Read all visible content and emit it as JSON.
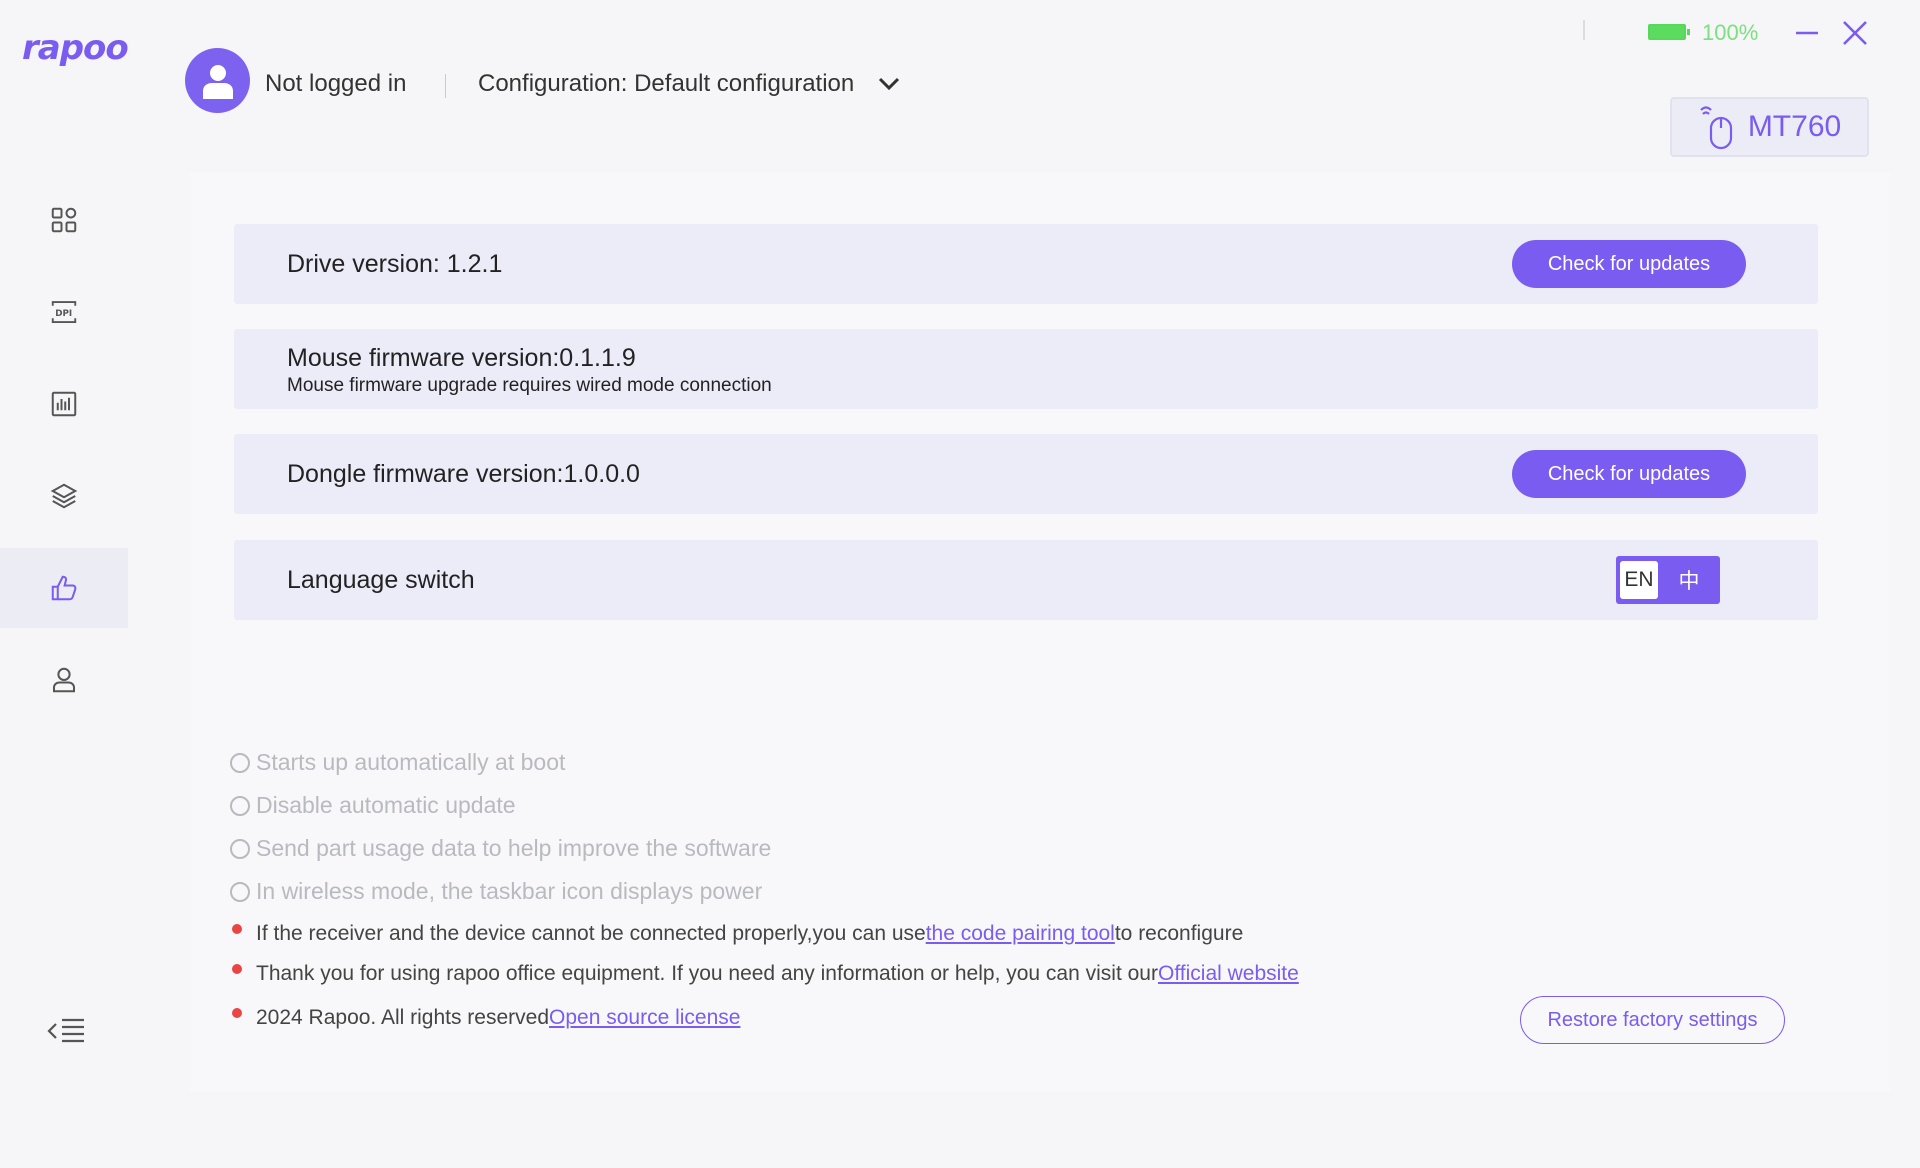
{
  "app": {
    "logo_text": "rapoo"
  },
  "sidebar": {
    "items": [
      {
        "name": "dashboard",
        "icon": "grid-icon",
        "active": false
      },
      {
        "name": "dpi",
        "icon": "dpi-icon",
        "active": false
      },
      {
        "name": "stats",
        "icon": "bar-chart-icon",
        "active": false
      },
      {
        "name": "layers",
        "icon": "layers-icon",
        "active": false
      },
      {
        "name": "settings",
        "icon": "thumbs-up-icon",
        "active": true
      },
      {
        "name": "account",
        "icon": "user-icon",
        "active": false
      }
    ],
    "collapse_icon": "collapse-menu-icon"
  },
  "header": {
    "login_status": "Not logged in",
    "configuration": "Configuration: Default configuration",
    "battery_percent": "100%",
    "battery_level": 1.0,
    "device_name": "MT760"
  },
  "cards": {
    "drive": {
      "title": "Drive version: 1.2.1",
      "button": "Check for updates"
    },
    "mouse_fw": {
      "title": "Mouse firmware version:0.1.1.9",
      "subtitle": "Mouse firmware upgrade requires wired mode connection"
    },
    "dongle_fw": {
      "title": "Dongle firmware version:1.0.0.0",
      "button": "Check for updates"
    },
    "language": {
      "title": "Language switch",
      "option_en": "EN",
      "option_zh": "中"
    }
  },
  "options": [
    "Starts up automatically at boot",
    "Disable automatic update",
    "Send part usage data to help improve the software",
    "In wireless mode, the taskbar icon displays power"
  ],
  "info": {
    "pairing": {
      "before": "If the receiver and the device cannot be connected properly,you can use",
      "link": "the code pairing tool",
      "after": "to reconfigure"
    },
    "website": {
      "before": "Thank you for using rapoo office equipment. If you need any information or help, you can visit our",
      "link": "Official website"
    },
    "license": {
      "before": "2024 Rapoo. All rights reserved",
      "link": "Open source license"
    }
  },
  "restore_button": "Restore factory settings",
  "colors": {
    "accent": "#7a5cf0",
    "card_bg": "#ececf9",
    "battery": "#5bdc5e",
    "bullet": "#e84545"
  }
}
